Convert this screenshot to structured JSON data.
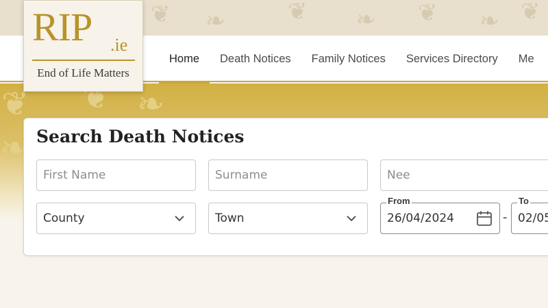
{
  "logo": {
    "brand": "RIP",
    "tld": ".ie",
    "tagline": "End of Life Matters"
  },
  "nav": {
    "items": [
      {
        "label": "Home",
        "active": true
      },
      {
        "label": "Death Notices"
      },
      {
        "label": "Family Notices"
      },
      {
        "label": "Services Directory"
      },
      {
        "label": "Me"
      }
    ]
  },
  "search": {
    "title": "Search Death Notices",
    "first_name_placeholder": "First Name",
    "surname_placeholder": "Surname",
    "nee_placeholder": "Nee",
    "county_value": "County",
    "town_value": "Town",
    "from_label": "From",
    "from_value": "26/04/2024",
    "range_separator": "-",
    "to_label": "To",
    "to_value": "02/05"
  },
  "icons": {
    "select_chevron": "chevron-down-icon",
    "date_picker": "calendar-icon",
    "decoration": "leaf-icon"
  },
  "colors": {
    "accent_gold": "#c9a640",
    "logo_gold": "#b8932a",
    "page_background": "#f8f4ec"
  }
}
